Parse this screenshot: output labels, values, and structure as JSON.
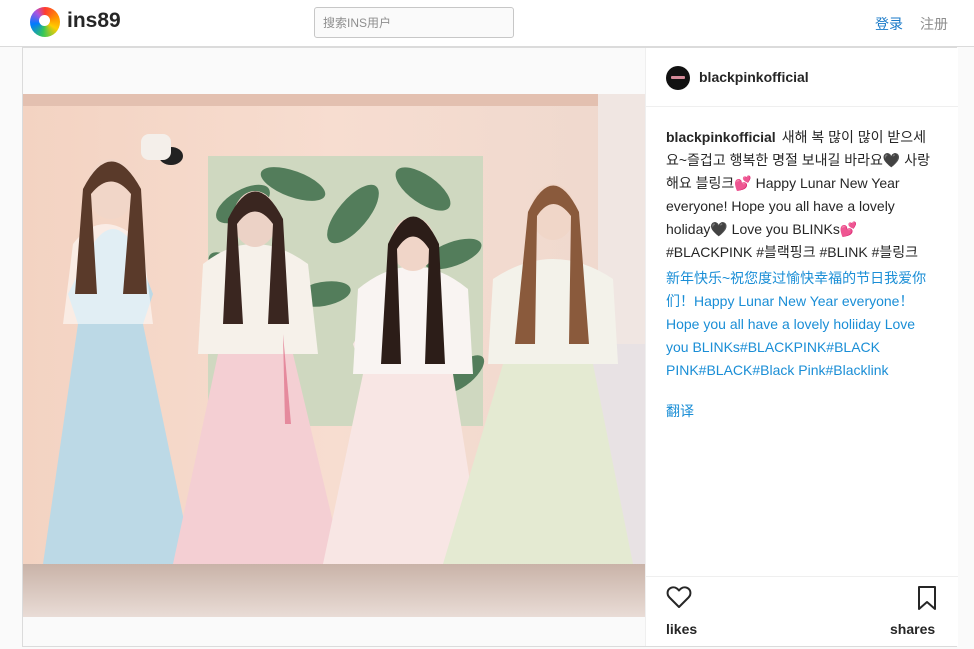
{
  "header": {
    "brand": "ins89",
    "search_placeholder": "搜索INS用户",
    "login_label": "登录",
    "register_label": "注册"
  },
  "post": {
    "username": "blackpinkofficial",
    "caption": "새해 복 많이 많이 받으세요~즐겁고 행복한 명절 보내길 바라요🖤 사랑해요 블링크💕 Happy Lunar New Year everyone! Hope you all have a lovely holiday🖤 Love you BLINKs💕 #BLACKPINK #블랙핑크 #BLINK #블링크",
    "translation": "新年快乐~祝您度过愉快幸福的节日我爱你们！Happy Lunar New Year everyone！Hope you all have a lovely holiiday Love you BLINKs#BLACKPINK#BLACK PINK#BLACK#Black Pink#Blacklink",
    "translate_label": "翻译",
    "likes_label": "likes",
    "shares_label": "shares",
    "photo_alt": "Four women in pastel hanbok standing in a room"
  },
  "icons": {
    "logo": "logo-icon",
    "avatar": "avatar",
    "like": "heart-icon",
    "share": "bookmark-icon"
  },
  "colors": {
    "link_blue": "#1a7ac8",
    "translation_blue": "#1a8ed6",
    "border": "#dbdbdb"
  }
}
